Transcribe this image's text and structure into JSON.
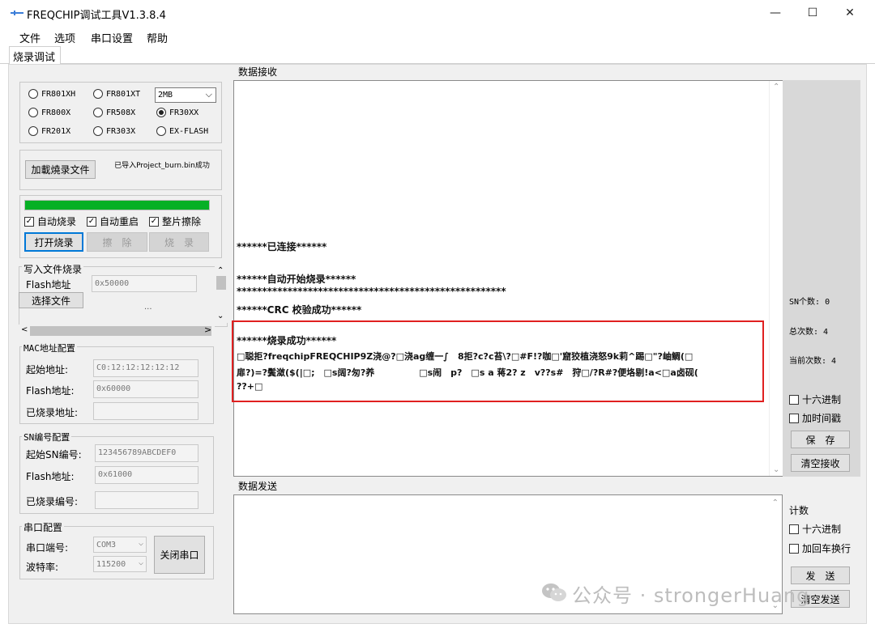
{
  "window": {
    "title": "FREQCHIP调试工具V1.3.8.4",
    "minimize": "—",
    "maximize": "☐",
    "close": "✕"
  },
  "menu": [
    "文件",
    "选项",
    "串口设置",
    "帮助"
  ],
  "tabs": [
    "烧录调试"
  ],
  "chip_select": {
    "options": [
      "FR801XH",
      "FR801XT",
      "FR800X",
      "FR508X",
      "FR30XX",
      "FR201X",
      "FR303X",
      "EX-FLASH"
    ],
    "selected": "FR30XX",
    "size_value": "2MB"
  },
  "load_file": {
    "button": "加載燒录文件",
    "status": "已导入Project_burn.bin成功"
  },
  "burn_options": {
    "progress_fraction": 1.0,
    "auto_burn": "自动烧录",
    "auto_restart": "自动重启",
    "chip_erase": "整片擦除",
    "open_burn": "打开烧录",
    "erase": "擦　除",
    "burn": "烧　录"
  },
  "write_file": {
    "group": "写入文件烧录",
    "flash_label": "Flash地址",
    "flash_value": "0x50000",
    "select_file": "选择文件",
    "ellipsis": "..."
  },
  "mac_config": {
    "group": "MAC地址配置",
    "start_label": "起始地址:",
    "start_value": "C0:12:12:12:12:12",
    "flash_label": "Flash地址:",
    "flash_value": "0x60000",
    "burned_label": "已烧录地址:",
    "burned_value": ""
  },
  "sn_config": {
    "group": "SN编号配置",
    "start_label": "起始SN编号:",
    "start_value": "123456789ABCDEF0",
    "flash_label": "Flash地址:",
    "flash_value": "0x61000",
    "burned_label": "已烧录编号:",
    "burned_value": ""
  },
  "serial_config": {
    "group": "串口配置",
    "port_label": "串口端号:",
    "port_value": "COM3",
    "baud_label": "波特率:",
    "baud_value": "115200",
    "close_port": "关闭串口"
  },
  "receive": {
    "group": "数据接收",
    "lines": [
      "******已连接******",
      "******自动开始烧录******",
      "*****************************************************",
      "******CRC 校验成功******",
      "******烧录成功******",
      "□聪拒?freqchipFREQCHIP9Z浇@?□浇ag缠一∫　8拒?c?c苔\\?□#F!?咖□'窟狡植浇怒9k莉^踢□\"?岫鲷(□",
      "扉?)=?鬓潋($(|□;　□s阔?匆?养　　　　　□s闹　p?　□s a 蒋2? z　v??s#　狩□/?R#?便垎剔!a<□a卤砚(",
      "??+□"
    ],
    "sn_count": "SN个数: 0",
    "total_count": "总次数: 4",
    "current_count": "当前次数: 4",
    "hex": "十六进制",
    "timestamp": "加时间戳",
    "save": "保　存",
    "clear_recv": "清空接收"
  },
  "send": {
    "group": "数据发送",
    "count": "计数",
    "hex": "十六进制",
    "crlf": "加回车换行",
    "send_btn": "发　送",
    "clear_send": "清空发送"
  },
  "watermark": "公众号 · strongerHuang"
}
